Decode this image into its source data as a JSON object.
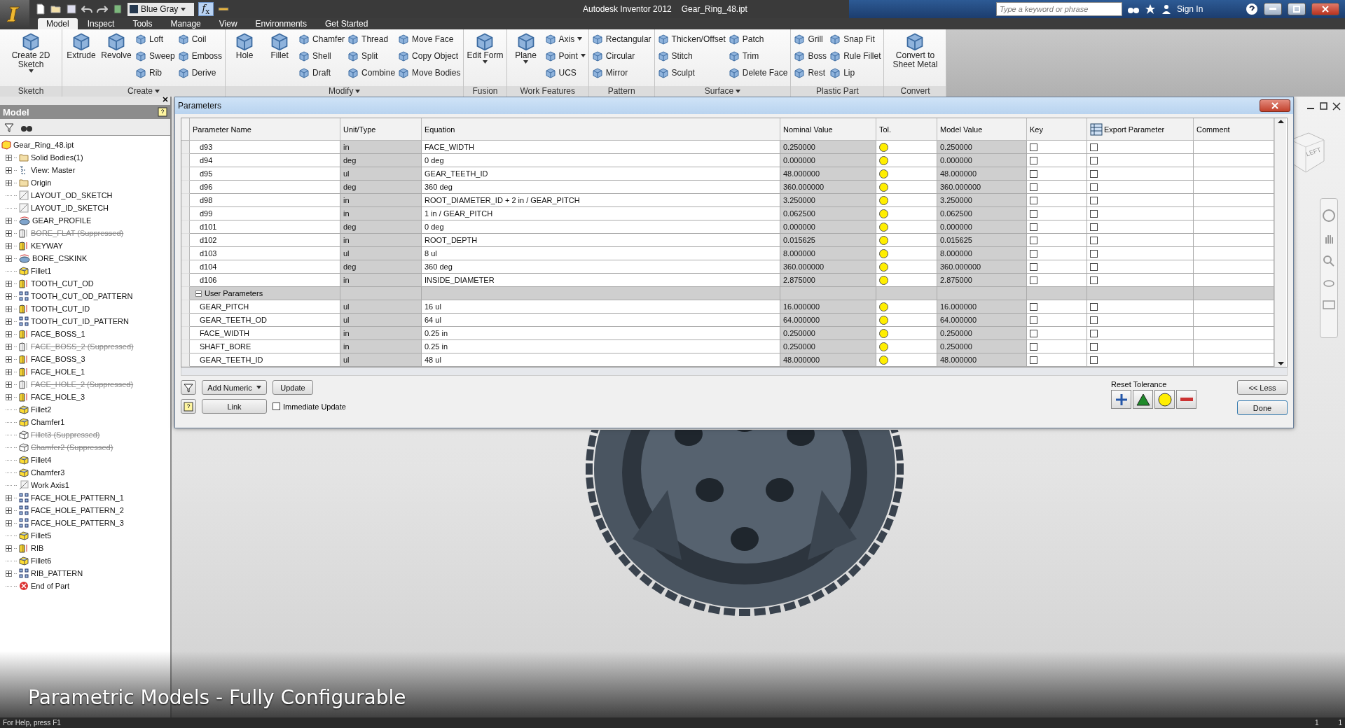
{
  "app": {
    "title": "Autodesk Inventor 2012",
    "document": "Gear_Ring_48.ipt",
    "search_placeholder": "Type a keyword or phrase",
    "sign_in": "Sign In",
    "style_select": "Blue Gray",
    "formula_button": "*f*$_{x}$"
  },
  "ribbon": {
    "tabs": [
      {
        "label": "Model",
        "selected": true
      },
      {
        "label": "Inspect",
        "selected": false
      },
      {
        "label": "Tools",
        "selected": false
      },
      {
        "label": "Manage",
        "selected": false
      },
      {
        "label": "View",
        "selected": false
      },
      {
        "label": "Environments",
        "selected": false
      },
      {
        "label": "Get Started",
        "selected": false
      }
    ],
    "panels": [
      {
        "title": "Sketch",
        "menu": false,
        "tools": [
          {
            "label": "Create 2D Sketch",
            "kind": "large",
            "dropdown": true
          }
        ]
      },
      {
        "title": "Create",
        "menu": true,
        "tools": [
          {
            "label": "Extrude",
            "kind": "large",
            "dropdown": false
          },
          {
            "label": "Revolve",
            "kind": "large",
            "dropdown": false
          },
          {
            "label": "Loft",
            "kind": "small",
            "dropdown": false
          },
          {
            "label": "Sweep",
            "kind": "small",
            "dropdown": false
          },
          {
            "label": "Rib",
            "kind": "small",
            "dropdown": false
          },
          {
            "label": "Coil",
            "kind": "small",
            "dropdown": false
          },
          {
            "label": "Emboss",
            "kind": "small",
            "dropdown": false
          },
          {
            "label": "Derive",
            "kind": "small",
            "dropdown": false
          }
        ]
      },
      {
        "title": "Modify",
        "menu": true,
        "tools": [
          {
            "label": "Hole",
            "kind": "large",
            "dropdown": false
          },
          {
            "label": "Fillet",
            "kind": "large",
            "dropdown": false
          },
          {
            "label": "Chamfer",
            "kind": "small",
            "dropdown": false
          },
          {
            "label": "Shell",
            "kind": "small",
            "dropdown": false
          },
          {
            "label": "Draft",
            "kind": "small",
            "dropdown": false
          },
          {
            "label": "Thread",
            "kind": "small",
            "dropdown": false
          },
          {
            "label": "Split",
            "kind": "small",
            "dropdown": false
          },
          {
            "label": "Combine",
            "kind": "small",
            "dropdown": false
          },
          {
            "label": "Move Face",
            "kind": "small",
            "dropdown": false
          },
          {
            "label": "Copy Object",
            "kind": "small",
            "dropdown": false
          },
          {
            "label": "Move Bodies",
            "kind": "small",
            "dropdown": false
          }
        ]
      },
      {
        "title": "Fusion",
        "menu": false,
        "tools": [
          {
            "label": "Edit Form",
            "kind": "large",
            "dropdown": true
          }
        ]
      },
      {
        "title": "Work Features",
        "menu": false,
        "tools": [
          {
            "label": "Plane",
            "kind": "large",
            "dropdown": true
          },
          {
            "label": "Axis",
            "kind": "small",
            "dropdown": true
          },
          {
            "label": "Point",
            "kind": "small",
            "dropdown": true
          },
          {
            "label": "UCS",
            "kind": "small",
            "dropdown": false
          }
        ]
      },
      {
        "title": "Pattern",
        "menu": false,
        "tools": [
          {
            "label": "Rectangular",
            "kind": "small",
            "dropdown": false
          },
          {
            "label": "Circular",
            "kind": "small",
            "dropdown": false
          },
          {
            "label": "Mirror",
            "kind": "small",
            "dropdown": false
          }
        ]
      },
      {
        "title": "Surface",
        "menu": true,
        "tools": [
          {
            "label": "Thicken/Offset",
            "kind": "small",
            "dropdown": false
          },
          {
            "label": "Stitch",
            "kind": "small",
            "dropdown": false
          },
          {
            "label": "Sculpt",
            "kind": "small",
            "dropdown": false
          },
          {
            "label": "Patch",
            "kind": "small",
            "dropdown": false
          },
          {
            "label": "Trim",
            "kind": "small",
            "dropdown": false
          },
          {
            "label": "Delete Face",
            "kind": "small",
            "dropdown": false
          }
        ]
      },
      {
        "title": "Plastic Part",
        "menu": false,
        "tools": [
          {
            "label": "Grill",
            "kind": "small",
            "dropdown": false
          },
          {
            "label": "Boss",
            "kind": "small",
            "dropdown": false
          },
          {
            "label": "Rest",
            "kind": "small",
            "dropdown": false
          },
          {
            "label": "Snap Fit",
            "kind": "small",
            "dropdown": false
          },
          {
            "label": "Rule Fillet",
            "kind": "small",
            "dropdown": false
          },
          {
            "label": "Lip",
            "kind": "small",
            "dropdown": false
          }
        ]
      },
      {
        "title": "Convert",
        "menu": false,
        "tools": [
          {
            "label": "Convert to Sheet Metal",
            "kind": "large",
            "dropdown": false
          }
        ]
      }
    ]
  },
  "browser": {
    "title": "Model",
    "tree": [
      {
        "label": "Gear_Ring_48.ipt",
        "kind": "part",
        "suppressed": false,
        "children": [
          {
            "label": "Solid Bodies(1)",
            "kind": "bodies",
            "expandable": true,
            "suppressed": false
          },
          {
            "label": "View: Master",
            "kind": "view",
            "expandable": true,
            "suppressed": false
          },
          {
            "label": "Origin",
            "kind": "folder",
            "expandable": true,
            "suppressed": false
          },
          {
            "label": "LAYOUT_OD_SKETCH",
            "kind": "sketch",
            "expandable": false,
            "suppressed": false
          },
          {
            "label": "LAYOUT_ID_SKETCH",
            "kind": "sketch",
            "expandable": false,
            "suppressed": false
          },
          {
            "label": "GEAR_PROFILE",
            "kind": "revolve",
            "expandable": true,
            "suppressed": false
          },
          {
            "label": "BORE_FLAT (Suppressed)",
            "kind": "extrude",
            "expandable": true,
            "suppressed": true
          },
          {
            "label": "KEYWAY",
            "kind": "extrude",
            "expandable": true,
            "suppressed": false
          },
          {
            "label": "BORE_CSKINK",
            "kind": "revolve",
            "expandable": true,
            "suppressed": false
          },
          {
            "label": "Fillet1",
            "kind": "fillet",
            "expandable": false,
            "suppressed": false
          },
          {
            "label": "TOOTH_CUT_OD",
            "kind": "extrude",
            "expandable": true,
            "suppressed": false
          },
          {
            "label": "TOOTH_CUT_OD_PATTERN",
            "kind": "pattern",
            "expandable": true,
            "suppressed": false
          },
          {
            "label": "TOOTH_CUT_ID",
            "kind": "extrude",
            "expandable": true,
            "suppressed": false
          },
          {
            "label": "TOOTH_CUT_ID_PATTERN",
            "kind": "pattern",
            "expandable": true,
            "suppressed": false
          },
          {
            "label": "FACE_BOSS_1",
            "kind": "extrude",
            "expandable": true,
            "suppressed": false
          },
          {
            "label": "FACE_BOSS_2 (Suppressed)",
            "kind": "extrude",
            "expandable": true,
            "suppressed": true
          },
          {
            "label": "FACE_BOSS_3",
            "kind": "extrude",
            "expandable": true,
            "suppressed": false
          },
          {
            "label": "FACE_HOLE_1",
            "kind": "extrude",
            "expandable": true,
            "suppressed": false
          },
          {
            "label": "FACE_HOLE_2 (Suppressed)",
            "kind": "extrude",
            "expandable": true,
            "suppressed": true
          },
          {
            "label": "FACE_HOLE_3",
            "kind": "extrude",
            "expandable": true,
            "suppressed": false
          },
          {
            "label": "Fillet2",
            "kind": "fillet",
            "expandable": false,
            "suppressed": false
          },
          {
            "label": "Chamfer1",
            "kind": "fillet",
            "expandable": false,
            "suppressed": false
          },
          {
            "label": "Fillet3 (Suppressed)",
            "kind": "fillet",
            "expandable": false,
            "suppressed": true
          },
          {
            "label": "Chamfer2 (Suppressed)",
            "kind": "fillet",
            "expandable": false,
            "suppressed": true
          },
          {
            "label": "Fillet4",
            "kind": "fillet",
            "expandable": false,
            "suppressed": false
          },
          {
            "label": "Chamfer3",
            "kind": "fillet",
            "expandable": false,
            "suppressed": false
          },
          {
            "label": "Work Axis1",
            "kind": "axis",
            "expandable": false,
            "suppressed": false
          },
          {
            "label": "FACE_HOLE_PATTERN_1",
            "kind": "pattern",
            "expandable": true,
            "suppressed": false
          },
          {
            "label": "FACE_HOLE_PATTERN_2",
            "kind": "pattern",
            "expandable": true,
            "suppressed": false
          },
          {
            "label": "FACE_HOLE_PATTERN_3",
            "kind": "pattern",
            "expandable": true,
            "suppressed": false
          },
          {
            "label": "Fillet5",
            "kind": "fillet",
            "expandable": false,
            "suppressed": false
          },
          {
            "label": "RIB",
            "kind": "extrude",
            "expandable": true,
            "suppressed": false
          },
          {
            "label": "Fillet6",
            "kind": "fillet",
            "expandable": false,
            "suppressed": false
          },
          {
            "label": "RIB_PATTERN",
            "kind": "pattern",
            "expandable": true,
            "suppressed": false
          },
          {
            "label": "End of Part",
            "kind": "end",
            "expandable": false,
            "suppressed": false
          }
        ]
      }
    ]
  },
  "params": {
    "title": "Parameters",
    "columns": [
      "Parameter Name",
      "Unit/Type",
      "Equation",
      "Nominal Value",
      "Tol.",
      "Model Value",
      "Key",
      "Export Parameter",
      "Comment"
    ],
    "rows": [
      {
        "kind": "param",
        "name": "d93",
        "unit": "in",
        "equation": "FACE_WIDTH",
        "nominal": "0.250000",
        "nominal_tolerance": true,
        "model": "0.250000",
        "key": false,
        "export": false
      },
      {
        "kind": "param",
        "name": "d94",
        "unit": "deg",
        "equation": "0 deg",
        "nominal": "0.000000",
        "nominal_tolerance": true,
        "model": "0.000000",
        "key": false,
        "export": false
      },
      {
        "kind": "param",
        "name": "d95",
        "unit": "ul",
        "equation": "GEAR_TEETH_ID",
        "nominal": "48.000000",
        "nominal_tolerance": true,
        "model": "48.000000",
        "key": false,
        "export": false
      },
      {
        "kind": "param",
        "name": "d96",
        "unit": "deg",
        "equation": "360 deg",
        "nominal": "360.000000",
        "nominal_tolerance": true,
        "model": "360.000000",
        "key": false,
        "export": false
      },
      {
        "kind": "param",
        "name": "d98",
        "unit": "in",
        "equation": "ROOT_DIAMETER_ID + 2 in / GEAR_PITCH",
        "nominal": "3.250000",
        "nominal_tolerance": true,
        "model": "3.250000",
        "key": false,
        "export": false
      },
      {
        "kind": "param",
        "name": "d99",
        "unit": "in",
        "equation": "1 in / GEAR_PITCH",
        "nominal": "0.062500",
        "nominal_tolerance": true,
        "model": "0.062500",
        "key": false,
        "export": false
      },
      {
        "kind": "param",
        "name": "d101",
        "unit": "deg",
        "equation": "0 deg",
        "nominal": "0.000000",
        "nominal_tolerance": true,
        "model": "0.000000",
        "key": false,
        "export": false
      },
      {
        "kind": "param",
        "name": "d102",
        "unit": "in",
        "equation": "ROOT_DEPTH",
        "nominal": "0.015625",
        "nominal_tolerance": true,
        "model": "0.015625",
        "key": false,
        "export": false
      },
      {
        "kind": "param",
        "name": "d103",
        "unit": "ul",
        "equation": "8 ul",
        "nominal": "8.000000",
        "nominal_tolerance": true,
        "model": "8.000000",
        "key": false,
        "export": false
      },
      {
        "kind": "param",
        "name": "d104",
        "unit": "deg",
        "equation": "360 deg",
        "nominal": "360.000000",
        "nominal_tolerance": true,
        "model": "360.000000",
        "key": false,
        "export": false
      },
      {
        "kind": "param",
        "name": "d106",
        "unit": "in",
        "equation": "INSIDE_DIAMETER",
        "nominal": "2.875000",
        "nominal_tolerance": true,
        "model": "2.875000",
        "key": false,
        "export": false
      },
      {
        "kind": "group",
        "name": "User Parameters",
        "expanded": true
      },
      {
        "kind": "param",
        "name": "GEAR_PITCH",
        "unit": "ul",
        "equation": "16 ul",
        "nominal": "16.000000",
        "nominal_tolerance": true,
        "model": "16.000000",
        "key": false,
        "export": false
      },
      {
        "kind": "param",
        "name": "GEAR_TEETH_OD",
        "unit": "ul",
        "equation": "64 ul",
        "nominal": "64.000000",
        "nominal_tolerance": true,
        "model": "64.000000",
        "key": false,
        "export": false
      },
      {
        "kind": "param",
        "name": "FACE_WIDTH",
        "unit": "in",
        "equation": "0.25 in",
        "nominal": "0.250000",
        "nominal_tolerance": true,
        "model": "0.250000",
        "key": false,
        "export": false
      },
      {
        "kind": "param",
        "name": "SHAFT_BORE",
        "unit": "in",
        "equation": "0.25 in",
        "nominal": "0.250000",
        "nominal_tolerance": true,
        "model": "0.250000",
        "key": false,
        "export": false
      },
      {
        "kind": "param",
        "name": "GEAR_TEETH_ID",
        "unit": "ul",
        "equation": "48 ul",
        "nominal": "48.000000",
        "nominal_tolerance": true,
        "model": "48.000000",
        "key": false,
        "export": false
      }
    ],
    "add_button": "Add Numeric",
    "update_button": "Update",
    "link_button": "Link",
    "immediate_update": {
      "label": "Immediate Update",
      "checked": false
    },
    "reset_tolerance": {
      "label": "Reset Tolerance",
      "buttons": [
        {
          "kind": "upper"
        },
        {
          "kind": "median"
        },
        {
          "kind": "nominal"
        },
        {
          "kind": "lower"
        }
      ]
    },
    "less_button": "<< Less",
    "done_button": "Done"
  },
  "viewcube": {
    "face": "LEFT"
  },
  "caption": "Parametric Models - Fully Configurable",
  "status_bar": {
    "help": "For Help, press F1",
    "values": [
      "1",
      "1"
    ]
  }
}
